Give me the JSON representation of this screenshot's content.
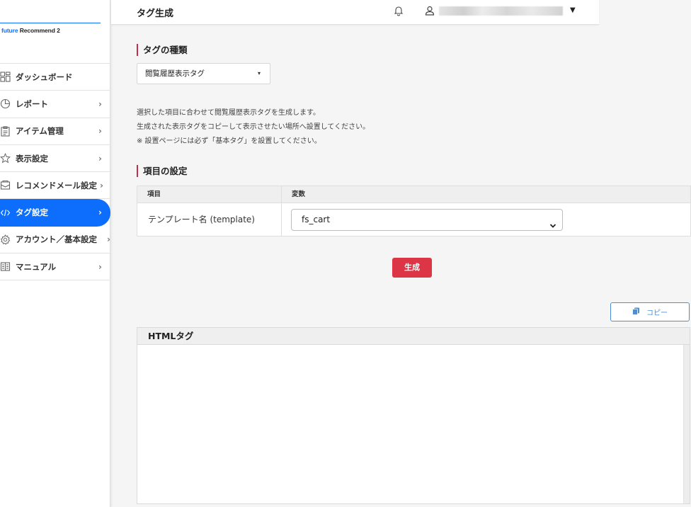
{
  "sidebar": {
    "logo_accent": "future",
    "logo_rest": " Recommend 2",
    "items": [
      {
        "label": "ダッシュボード",
        "icon": "dashboard-icon",
        "chevron": ""
      },
      {
        "label": "レポート",
        "icon": "report-icon",
        "chevron": "›"
      },
      {
        "label": "アイテム管理",
        "icon": "clipboard-icon",
        "chevron": "›"
      },
      {
        "label": "表示設定",
        "icon": "star-icon",
        "chevron": "›"
      },
      {
        "label": "レコメンドメール設定",
        "icon": "mail-icon",
        "chevron": "›"
      },
      {
        "label": "タグ設定",
        "icon": "code-icon",
        "chevron": "›"
      },
      {
        "label": "アカウント／基本設定",
        "icon": "gear-icon",
        "chevron": "›"
      },
      {
        "label": "マニュアル",
        "icon": "book-icon",
        "chevron": "›"
      }
    ],
    "active_index": 5
  },
  "header": {
    "title": "タグ生成",
    "caret": "▼"
  },
  "tag_type": {
    "title": "タグの種類",
    "selected": "閲覧履歴表示タグ",
    "caret": "▾"
  },
  "description": {
    "line1": "選択した項目に合わせて閲覧履歴表示タグを生成します。",
    "line2": "生成された表示タグをコピーして表示させたい場所へ設置してください。",
    "line3": "※ 設置ページには必ず「基本タグ」を設置してください。"
  },
  "settings": {
    "title": "項目の設定",
    "col_item": "項目",
    "col_var": "変数",
    "row_label": "テンプレート名 (template)",
    "row_value": "fs_cart"
  },
  "buttons": {
    "generate": "生成",
    "copy": "コピー"
  },
  "html_panel": {
    "title": "HTMLタグ"
  },
  "colors": {
    "primary": "#0d6efd",
    "danger": "#dc3545",
    "accent_bar": "#c0304a"
  }
}
